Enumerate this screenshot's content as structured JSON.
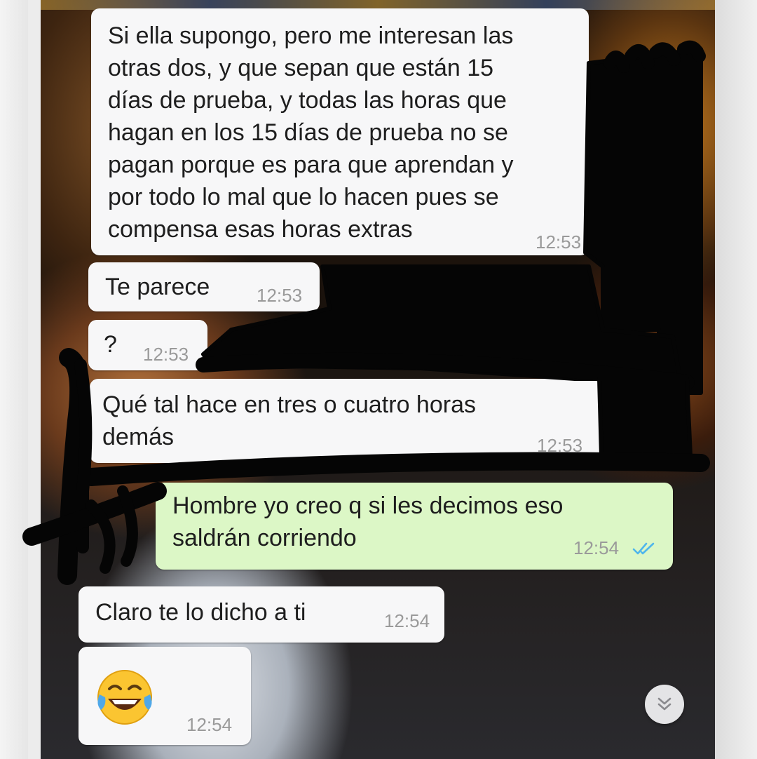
{
  "chat": {
    "messages": [
      {
        "direction": "incoming",
        "text": "Si ella supongo, pero me interesan las\notras dos, y que sepan que están 15\ndías de prueba, y todas las horas que\nhagan en los 15 días de prueba no se\npagan porque es para que aprendan y\npor todo lo mal que lo hacen pues se\ncompensa esas horas extras",
        "time": "12:53"
      },
      {
        "direction": "incoming",
        "text": "Te parece",
        "time": "12:53"
      },
      {
        "direction": "incoming",
        "text": "?",
        "time": "12:53"
      },
      {
        "direction": "incoming",
        "text": "Qué tal hace en tres o cuatro horas\ndemás",
        "time": "12:53"
      },
      {
        "direction": "outgoing",
        "text": "Hombre yo creo q si les decimos eso\nsaldrán corriendo",
        "time": "12:54",
        "status": "read"
      },
      {
        "direction": "incoming",
        "text": "Claro te lo dicho a ti",
        "time": "12:54"
      },
      {
        "direction": "incoming",
        "emoji": "face-with-tears-of-joy",
        "time": "12:54"
      }
    ]
  },
  "icons": {
    "read_receipt": "double-check-icon",
    "scroll_down": "chevron-double-down-icon",
    "read_color": "#4fb6ec"
  }
}
